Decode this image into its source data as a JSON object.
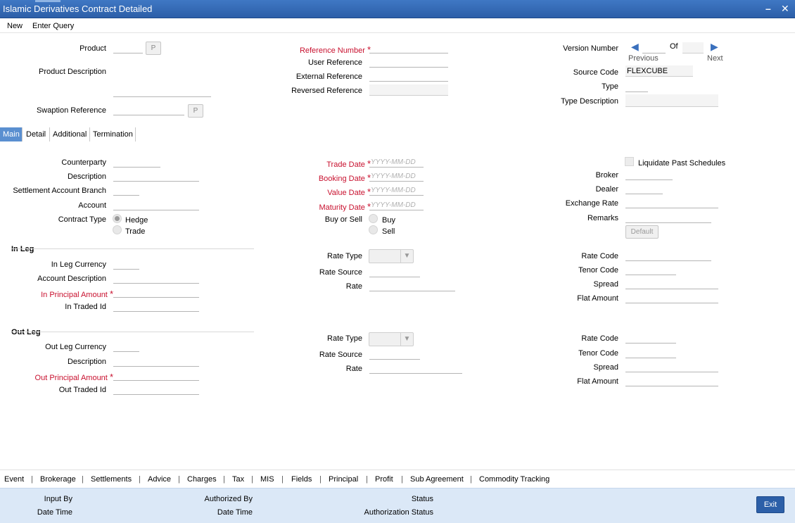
{
  "window": {
    "title": "Islamic Derivatives Contract Detailed",
    "minimize": "–",
    "close": "✕"
  },
  "menu": {
    "new": "New",
    "enter_query": "Enter Query"
  },
  "header": {
    "product": "Product",
    "product_btn": "P",
    "product_description": "Product Description",
    "swaption_reference": "Swaption Reference",
    "swaption_btn": "P",
    "reference_number": "Reference Number",
    "user_reference": "User Reference",
    "external_reference": "External Reference",
    "reversed_reference": "Reversed Reference",
    "version_number": "Version Number",
    "of": "Of",
    "previous": "Previous",
    "next": "Next",
    "source_code": "Source Code",
    "source_code_value": "FLEXCUBE",
    "type": "Type",
    "type_description": "Type Description"
  },
  "tabs": [
    {
      "label": "Main",
      "active": true
    },
    {
      "label": "Detail",
      "active": false
    },
    {
      "label": "Additional",
      "active": false
    },
    {
      "label": "Termination",
      "active": false
    }
  ],
  "main": {
    "counterparty": "Counterparty",
    "description": "Description",
    "settlement_account_branch": "Settlement Account Branch",
    "account": "Account",
    "contract_type": "Contract Type",
    "hedge": "Hedge",
    "trade": "Trade",
    "trade_date": "Trade Date",
    "booking_date": "Booking Date",
    "value_date": "Value Date",
    "maturity_date": "Maturity Date",
    "date_placeholder": "YYYY-MM-DD",
    "buy_or_sell": "Buy or Sell",
    "buy": "Buy",
    "sell": "Sell",
    "liquidate_past_schedules": "Liquidate Past Schedules",
    "broker": "Broker",
    "dealer": "Dealer",
    "exchange_rate": "Exchange Rate",
    "remarks": "Remarks",
    "default_btn": "Default"
  },
  "in_leg": {
    "heading": "In Leg",
    "currency": "In Leg Currency",
    "account_description": "Account Description",
    "principal_amount": "In Principal Amount",
    "traded_id": "In Traded Id",
    "rate_type": "Rate Type",
    "rate_source": "Rate Source",
    "rate": "Rate",
    "rate_code": "Rate Code",
    "tenor_code": "Tenor Code",
    "spread": "Spread",
    "flat_amount": "Flat Amount"
  },
  "out_leg": {
    "heading": "Out Leg",
    "currency": "Out Leg Currency",
    "description": "Description",
    "principal_amount": "Out Principal Amount",
    "traded_id": "Out Traded Id",
    "rate_type": "Rate Type",
    "rate_source": "Rate Source",
    "rate": "Rate",
    "rate_code": "Rate Code",
    "tenor_code": "Tenor Code",
    "spread": "Spread",
    "flat_amount": "Flat Amount"
  },
  "bottom_nav": [
    "Event",
    "Brokerage",
    "Settlements",
    "Advice",
    "Charges",
    "Tax",
    "MIS",
    "Fields",
    "Principal",
    "Profit",
    "Sub Agreement",
    "Commodity Tracking"
  ],
  "footer": {
    "input_by": "Input By",
    "date_time_1": "Date Time",
    "authorized_by": "Authorized By",
    "date_time_2": "Date Time",
    "status": "Status",
    "authorization_status": "Authorization Status",
    "exit": "Exit"
  },
  "required_mark": "*",
  "icons": {
    "arrow_left": "◀",
    "arrow_right": "▶",
    "dropdown": "▼"
  }
}
